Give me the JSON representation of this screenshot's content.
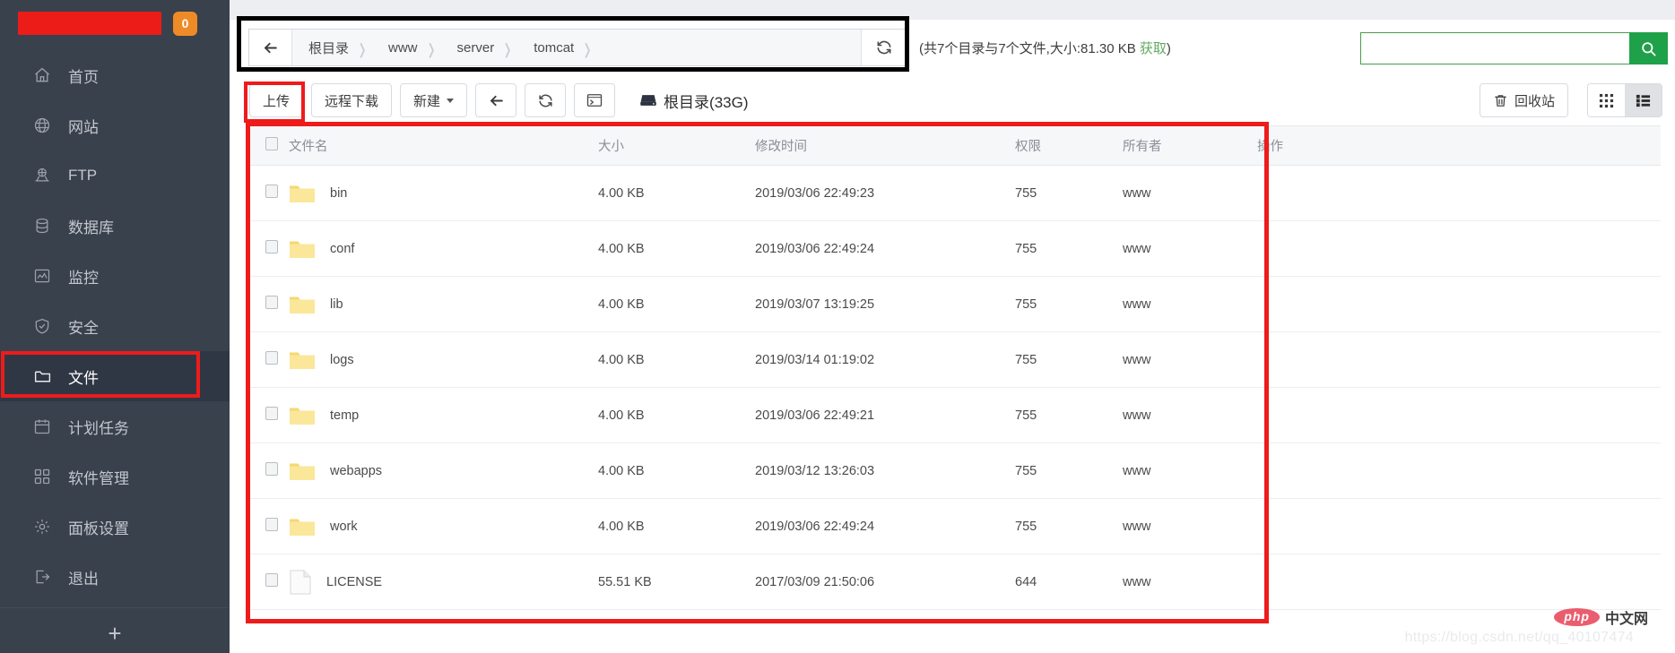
{
  "sidebar": {
    "badge_count": "0",
    "logo_redacted": true,
    "items": [
      {
        "label": "首页",
        "icon": "home-icon",
        "active": false
      },
      {
        "label": "网站",
        "icon": "globe-icon",
        "active": false
      },
      {
        "label": "FTP",
        "icon": "ftp-icon",
        "active": false
      },
      {
        "label": "数据库",
        "icon": "database-icon",
        "active": false
      },
      {
        "label": "监控",
        "icon": "monitor-icon",
        "active": false
      },
      {
        "label": "安全",
        "icon": "shield-icon",
        "active": false
      },
      {
        "label": "文件",
        "icon": "folder-icon",
        "active": true
      },
      {
        "label": "计划任务",
        "icon": "calendar-icon",
        "active": false
      },
      {
        "label": "软件管理",
        "icon": "apps-icon",
        "active": false
      },
      {
        "label": "面板设置",
        "icon": "gear-icon",
        "active": false
      },
      {
        "label": "退出",
        "icon": "logout-icon",
        "active": false
      }
    ],
    "add_label": "+"
  },
  "pathbar": {
    "back_icon": "arrow-left-icon",
    "refresh_icon": "refresh-icon",
    "crumbs": [
      "根目录",
      "www",
      "server",
      "tomcat"
    ],
    "separator": "›",
    "summary_prefix": "(共7个目录与7个文件,大小:81.30 KB ",
    "summary_link": "获取",
    "summary_suffix": ")"
  },
  "search": {
    "value": "",
    "placeholder": "",
    "icon": "search-icon"
  },
  "toolbar": {
    "upload_label": "上传",
    "remote_download_label": "远程下载",
    "new_label": "新建",
    "back_icon": "arrow-left-icon",
    "refresh_icon": "refresh-icon",
    "terminal_icon": "terminal-icon",
    "root_label": "根目录(33G)",
    "root_icon": "hdd-icon",
    "recycle_label": "回收站",
    "recycle_icon": "trash-icon",
    "grid_view_icon": "grid-view-icon",
    "list_view_icon": "list-view-icon",
    "view_selected": "list"
  },
  "table": {
    "headers": {
      "check": "",
      "name": "文件名",
      "size": "大小",
      "mtime": "修改时间",
      "perm": "权限",
      "owner": "所有者",
      "action": "操作"
    },
    "rows": [
      {
        "name": "bin",
        "type": "folder",
        "size": "4.00 KB",
        "mtime": "2019/03/06 22:49:23",
        "perm": "755",
        "owner": "www"
      },
      {
        "name": "conf",
        "type": "folder",
        "size": "4.00 KB",
        "mtime": "2019/03/06 22:49:24",
        "perm": "755",
        "owner": "www"
      },
      {
        "name": "lib",
        "type": "folder",
        "size": "4.00 KB",
        "mtime": "2019/03/07 13:19:25",
        "perm": "755",
        "owner": "www"
      },
      {
        "name": "logs",
        "type": "folder",
        "size": "4.00 KB",
        "mtime": "2019/03/14 01:19:02",
        "perm": "755",
        "owner": "www"
      },
      {
        "name": "temp",
        "type": "folder",
        "size": "4.00 KB",
        "mtime": "2019/03/06 22:49:21",
        "perm": "755",
        "owner": "www"
      },
      {
        "name": "webapps",
        "type": "folder",
        "size": "4.00 KB",
        "mtime": "2019/03/12 13:26:03",
        "perm": "755",
        "owner": "www"
      },
      {
        "name": "work",
        "type": "folder",
        "size": "4.00 KB",
        "mtime": "2019/03/06 22:49:24",
        "perm": "755",
        "owner": "www"
      },
      {
        "name": "LICENSE",
        "type": "file",
        "size": "55.51 KB",
        "mtime": "2017/03/09 21:50:06",
        "perm": "644",
        "owner": "www"
      }
    ]
  },
  "watermark": {
    "php_badge": "php",
    "php_text": "中文网",
    "url": "https://blog.csdn.net/qq_40107474"
  },
  "colors": {
    "sidebar_bg": "#39414d",
    "sidebar_active_bg": "#2f3744",
    "accent_red": "#ee1b1b",
    "badge_orange": "#ef8b26",
    "search_green": "#1fa14a",
    "link_green": "#63a95f",
    "folder_yellow": "#f7dd7e"
  }
}
